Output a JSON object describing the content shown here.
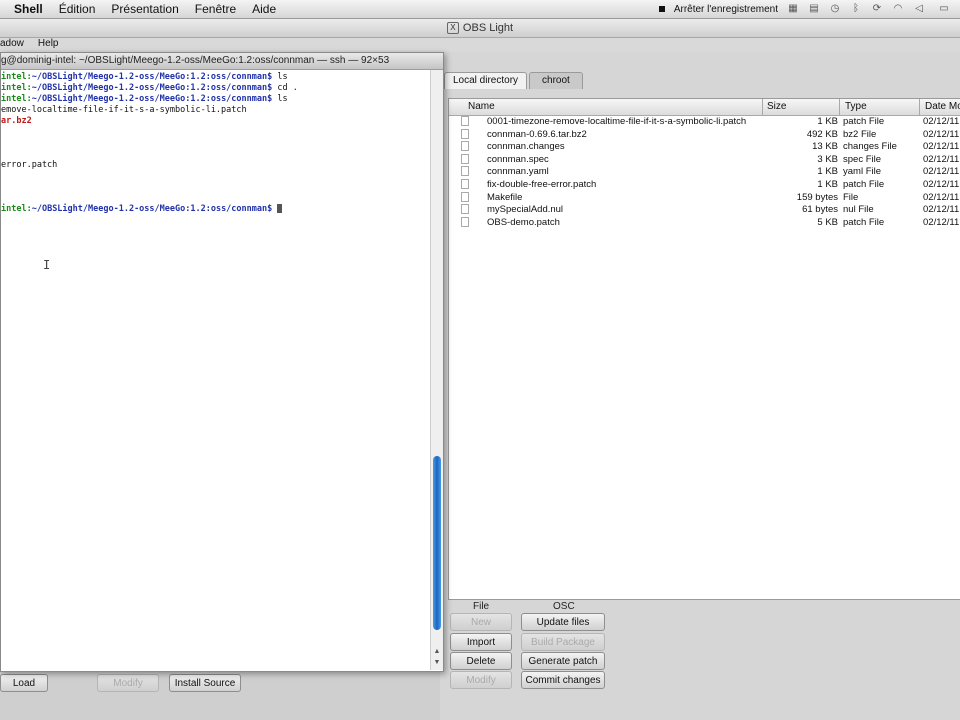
{
  "menubar": {
    "items": [
      "Shell",
      "Édition",
      "Présentation",
      "Fenêtre",
      "Aide"
    ],
    "recording_label": "Arrêter l'enregistrement"
  },
  "obs_window": {
    "title": "OBS Light",
    "menu": [
      "adow",
      "Help"
    ]
  },
  "terminal": {
    "title": "g@dominig-intel: ~/OBSLight/Meego-1.2-oss/MeeGo:1.2:oss/connman — ssh — 92×53",
    "prompt_user": "intel:",
    "prompt_path": "~/OBSLight/Meego-1.2-oss/MeeGo:1.2:oss/connman$",
    "lines": [
      {
        "kind": "prompt",
        "cmd": " ls"
      },
      {
        "kind": "prompt",
        "cmd": " cd ."
      },
      {
        "kind": "prompt",
        "cmd": " ls"
      },
      {
        "kind": "text",
        "text": "emove-localtime-file-if-it-s-a-symbolic-li.patch"
      },
      {
        "kind": "red",
        "text": "ar.bz2"
      },
      {
        "kind": "text",
        "text": ""
      },
      {
        "kind": "text",
        "text": ""
      },
      {
        "kind": "text",
        "text": ""
      },
      {
        "kind": "text",
        "text": "error.patch"
      },
      {
        "kind": "text",
        "text": ""
      },
      {
        "kind": "text",
        "text": ""
      },
      {
        "kind": "text",
        "text": ""
      },
      {
        "kind": "prompt_cursor",
        "cmd": " "
      }
    ]
  },
  "left_buttons": {
    "load": "Load",
    "modify": "Modify",
    "install_source": "Install Source"
  },
  "tabs": [
    {
      "label": "Local directory",
      "active": true
    },
    {
      "label": "chroot",
      "active": false
    }
  ],
  "file_table": {
    "headers": {
      "name": "Name",
      "size": "Size",
      "type": "Type",
      "date": "Date Mo"
    },
    "rows": [
      {
        "name": "0001-timezone-remove-localtime-file-if-it-s-a-symbolic-li.patch",
        "size": "1 KB",
        "type": "patch File",
        "date": "02/12/11"
      },
      {
        "name": "connman-0.69.6.tar.bz2",
        "size": "492 KB",
        "type": "bz2 File",
        "date": "02/12/11"
      },
      {
        "name": "connman.changes",
        "size": "13 KB",
        "type": "changes File",
        "date": "02/12/11"
      },
      {
        "name": "connman.spec",
        "size": "3 KB",
        "type": "spec File",
        "date": "02/12/11"
      },
      {
        "name": "connman.yaml",
        "size": "1 KB",
        "type": "yaml File",
        "date": "02/12/11"
      },
      {
        "name": "fix-double-free-error.patch",
        "size": "1 KB",
        "type": "patch File",
        "date": "02/12/11"
      },
      {
        "name": "Makefile",
        "size": "159 bytes",
        "type": "File",
        "date": "02/12/11"
      },
      {
        "name": "mySpecialAdd.nul",
        "size": "61 bytes",
        "type": "nul File",
        "date": "02/12/11"
      },
      {
        "name": "OBS-demo.patch",
        "size": "5 KB",
        "type": "patch File",
        "date": "02/12/11"
      }
    ]
  },
  "file_group": {
    "label": "File",
    "new": "New",
    "import": "Import",
    "delete": "Delete",
    "modify": "Modify"
  },
  "osc_group": {
    "label": "OSC",
    "update_files": "Update files",
    "build_package": "Build Package",
    "generate_patch": "Generate patch",
    "commit_changes": "Commit changes"
  }
}
